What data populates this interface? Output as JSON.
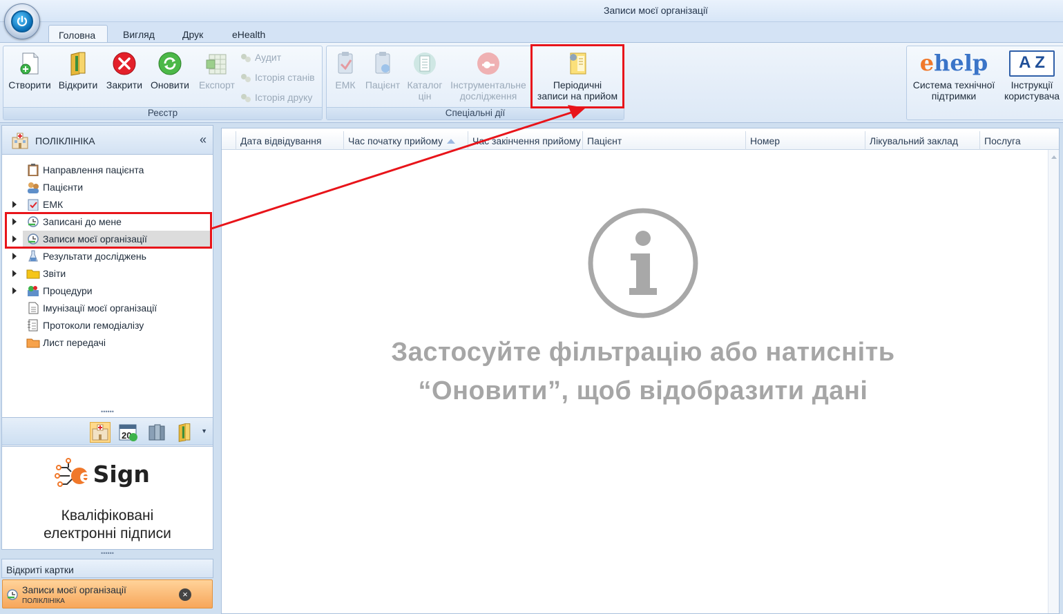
{
  "window": {
    "title": "Записи моєї організації"
  },
  "tabs": [
    "Головна",
    "Вигляд",
    "Друк",
    "eHealth"
  ],
  "ribbon": {
    "registry": {
      "label": "Реєстр",
      "create": "Створити",
      "open": "Відкрити",
      "close": "Закрити",
      "refresh": "Оновити",
      "export": "Експорт",
      "audit": "Аудит",
      "state_history": "Історія станів",
      "print_history": "Історія друку"
    },
    "special": {
      "label": "Спеціальні дії",
      "emk": "ЕМК",
      "patient": "Пацієнт",
      "catalog_line1": "Каталог",
      "catalog_line2": "цін",
      "instr_line1": "Інструментальне",
      "instr_line2": "дослідження",
      "periodic_line1": "Періодичні",
      "periodic_line2": "записи на прийом"
    },
    "help": {
      "ehelp_logo_e": "e",
      "ehelp_logo_rest": "help",
      "support_line1": "Система технічної",
      "support_line2": "підтримки",
      "az_logo": "A Z",
      "manual_line1": "Інструкції",
      "manual_line2": "користувача"
    }
  },
  "nav": {
    "title": "ПОЛІКЛІНІКА",
    "collapse": "«",
    "items": [
      {
        "label": "Направлення пацієнта"
      },
      {
        "label": "Пацієнти"
      },
      {
        "label": "ЕМК"
      },
      {
        "label": "Записані до мене"
      },
      {
        "label": "Записи моєї організації"
      },
      {
        "label": "Результати досліджень"
      },
      {
        "label": "Звіти"
      },
      {
        "label": "Процедури"
      },
      {
        "label": "Імунізації моєї організації"
      },
      {
        "label": "Протоколи гемодіалізу"
      },
      {
        "label": "Лист передачі"
      }
    ],
    "splitter": "••••••"
  },
  "toolbar_icons": [
    "hospital-icon",
    "calendar-icon",
    "books-icon",
    "folder-icon"
  ],
  "calendar_number": "20",
  "esign": {
    "brand_e": "e",
    "brand_rest": "Sign",
    "line1": "Кваліфіковані",
    "line2": "електронні підписи"
  },
  "open_cards": {
    "title": "Відкриті картки",
    "card_title": "Записи моєї організації",
    "card_sub": "ПОЛІКЛІНІКА",
    "close": "×"
  },
  "grid": {
    "columns": [
      "Дата відвідування",
      "Час початку прийому",
      "Час закінчення прийому",
      "Пацієнт",
      "Номер",
      "Лікувальний заклад",
      "Послуга"
    ],
    "empty_line1": "Застосуйте фільтрацію або натисніть",
    "empty_line2": "“Оновити”, щоб відобразити дані"
  },
  "colors": {
    "highlight": "#e8141a",
    "accent": "#0a6fb7",
    "selected_card": "#f7a65a"
  }
}
